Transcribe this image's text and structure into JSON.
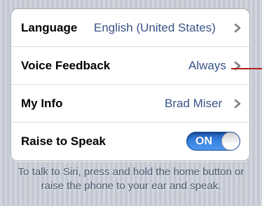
{
  "settings": {
    "rows": [
      {
        "label": "Language",
        "value": "English (United States)"
      },
      {
        "label": "Voice Feedback",
        "value": "Always"
      },
      {
        "label": "My Info",
        "value": "Brad Miser"
      },
      {
        "label": "Raise to Speak",
        "toggle": "ON"
      }
    ]
  },
  "footer": {
    "text": "To talk to Siri, press and hold the home button or raise the phone to your ear and speak."
  },
  "colors": {
    "value_blue": "#385487",
    "toggle_blue": "#3a86e5",
    "callout_red": "#b21e1e"
  }
}
